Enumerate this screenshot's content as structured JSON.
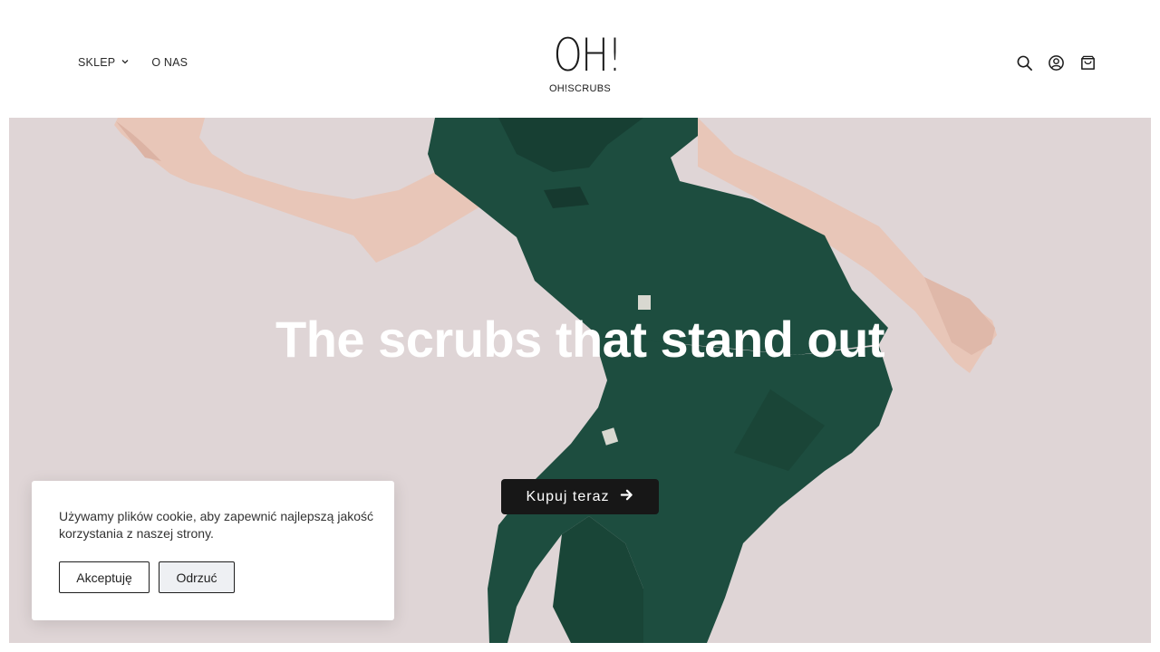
{
  "header": {
    "nav": [
      {
        "label": "SKLEP",
        "has_dropdown": true
      },
      {
        "label": "O NAS",
        "has_dropdown": false
      }
    ],
    "logo": {
      "mark": "OH!",
      "text": "OH!SCRUBS"
    },
    "icons": [
      "search-icon",
      "account-icon",
      "cart-icon"
    ]
  },
  "hero": {
    "title": "The scrubs that stand out",
    "cta_label": "Kupuj teraz",
    "background_color": "#dfd5d6",
    "garment_color": "#1d4d3f"
  },
  "cookie_banner": {
    "text": "Używamy plików cookie, aby zapewnić najlepszą jakość korzystania z naszej strony.",
    "accept_label": "Akceptuję",
    "reject_label": "Odrzuć"
  }
}
